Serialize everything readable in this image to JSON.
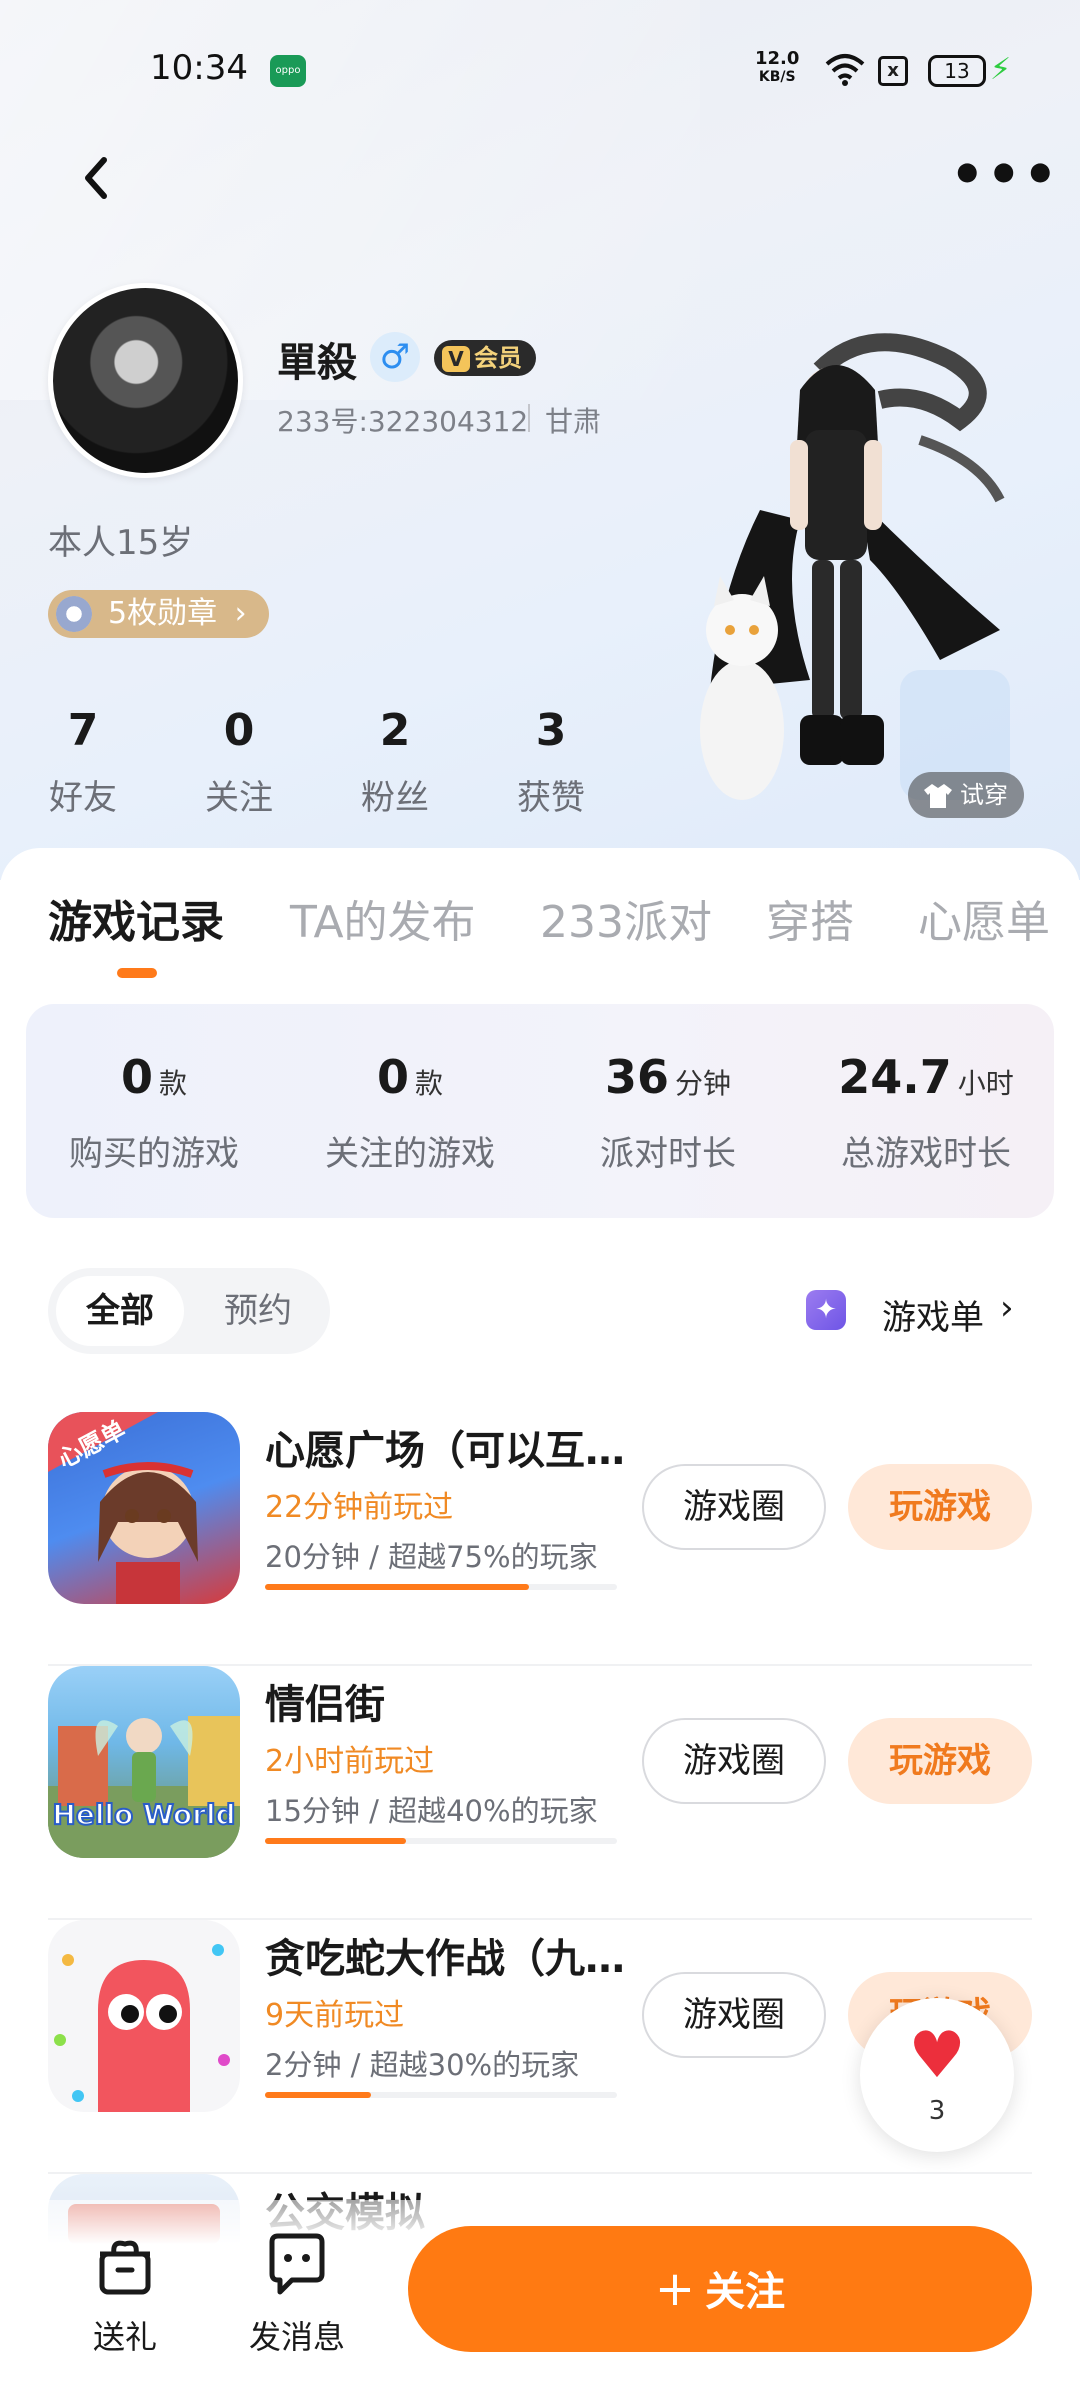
{
  "status_bar": {
    "time": "10:34",
    "app_icon_label": "oppo",
    "net_speed_value": "12.0",
    "net_speed_unit": "KB/S",
    "sim_label": "x",
    "battery": "13",
    "charging_icon": "bolt-icon"
  },
  "profile": {
    "name": "單殺",
    "gender_symbol": "♂",
    "vip_label": "会员",
    "id": "233号:322304312",
    "region": "甘肃",
    "bio": "本人15岁",
    "medals": "5枚勋章",
    "medals_chevron": "›",
    "try_on": "试穿"
  },
  "stats": [
    {
      "value": "7",
      "label": "好友"
    },
    {
      "value": "0",
      "label": "关注"
    },
    {
      "value": "2",
      "label": "粉丝"
    },
    {
      "value": "3",
      "label": "获赞"
    }
  ],
  "tabs": [
    "游戏记录",
    "TA的发布",
    "233派对",
    "穿搭",
    "心愿单"
  ],
  "summary": [
    {
      "value": "0",
      "unit": "款",
      "label": "购买的游戏"
    },
    {
      "value": "0",
      "unit": "款",
      "label": "关注的游戏"
    },
    {
      "value": "36",
      "unit": "分钟",
      "label": "派对时长"
    },
    {
      "value": "24.7",
      "unit": "小时",
      "label": "总游戏时长"
    }
  ],
  "filters": {
    "all": "全部",
    "reserve": "预约",
    "gamelist": "游戏单",
    "chevron": "›"
  },
  "games": [
    {
      "name": "心愿广场（可以互…",
      "last_played": "22分钟前玩过",
      "stat": "20分钟 / 超越75%的玩家",
      "progress": 0.75,
      "circle_label": "游戏圈",
      "play_label": "玩游戏"
    },
    {
      "name": "情侣街",
      "last_played": "2小时前玩过",
      "stat": "15分钟 / 超越40%的玩家",
      "progress": 0.4,
      "circle_label": "游戏圈",
      "play_label": "玩游戏"
    },
    {
      "name": "贪吃蛇大作战（九…",
      "last_played": "9天前玩过",
      "stat": "2分钟 / 超越30%的玩家",
      "progress": 0.3,
      "circle_label": "游戏圈",
      "play_label": "玩游戏"
    },
    {
      "name": "公交模拟"
    }
  ],
  "game_icon_texts": {
    "wishlist": "心愿单",
    "hello_world": "Hello World"
  },
  "like": {
    "count": "3"
  },
  "bottom": {
    "gift": "送礼",
    "message": "发消息",
    "follow": "关注",
    "follow_plus": "+"
  },
  "colors": {
    "accent": "#ff7a12",
    "last_played": "#f08a24",
    "play_bg": "#ffe8d8"
  }
}
